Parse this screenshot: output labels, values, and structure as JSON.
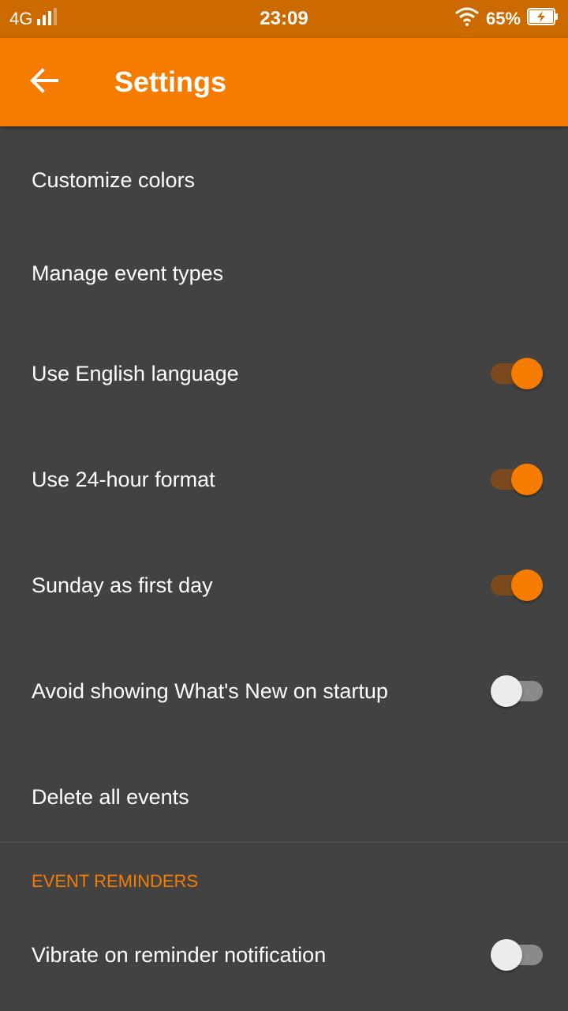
{
  "status_bar": {
    "network": "4G",
    "time": "23:09",
    "battery": "65%",
    "icons": [
      "signal-icon",
      "wifi-icon",
      "battery-charging-icon"
    ]
  },
  "app_bar": {
    "title": "Settings",
    "back_icon": "arrow-back-icon",
    "color": "#f57c00"
  },
  "settings": {
    "customize_colors": "Customize colors",
    "manage_event_types": "Manage event types",
    "use_english": {
      "label": "Use English language",
      "checked": true
    },
    "use_24_hour": {
      "label": "Use 24-hour format",
      "checked": true
    },
    "sunday_first": {
      "label": "Sunday as first day",
      "checked": true
    },
    "avoid_whats_new": {
      "label": "Avoid showing What's New on startup",
      "checked": false
    },
    "delete_all_events": "Delete all events"
  },
  "event_reminders": {
    "header": "EVENT REMINDERS",
    "vibrate": {
      "label": "Vibrate on reminder notification",
      "checked": false
    }
  },
  "colors": {
    "accent": "#f57c00",
    "status_bar": "#cc6a00",
    "background": "#424242"
  }
}
